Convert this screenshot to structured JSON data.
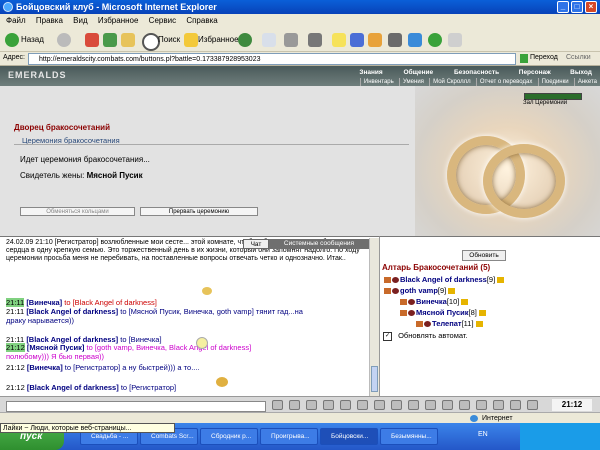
{
  "window": {
    "title": "Бойцовский клуб - Microsoft Internet Explorer"
  },
  "menu": [
    "Файл",
    "Правка",
    "Вид",
    "Избранное",
    "Сервис",
    "Справка"
  ],
  "toolbar": {
    "back": "Назад",
    "search": "Поиск",
    "favorites": "Избранное",
    "go": "Переход",
    "links": "Ссылки"
  },
  "address": {
    "label": "Адрес:",
    "url": "http://emeraldscity.combats.com/buttons.pl?battle=0.173387928953023"
  },
  "game_header": {
    "logo": "EMERALDS",
    "nav_top": [
      "Знания",
      "Общение",
      "Безопасность",
      "Персонаж",
      "Выход"
    ],
    "nav_bottom": [
      "Инвентарь",
      "Умения",
      "Мой Скроллл",
      "Отчет о переводах",
      "Поединки",
      "Анкета"
    ]
  },
  "main": {
    "hall_title": "Дворец бракосочетаний",
    "ceremony_tab": "Церемония бракосочетания",
    "ceremony_status": "Идет церемония бракосочетания...",
    "witness_label": "Свидетель жены:",
    "witness_name": "Мясной Пусик",
    "ceremony_text": "24.02.09 21:10 [Регистратор] возлюбленные мои сесте... этой комнате, чтобы объединить два любящих сердца в одну крепкую семью. Это торжественный день в их жизни, который они запомнят надолго. По ходу церемонии просьба меня не перебивать, на поставленные вопросы отвечать четко и однозначно. Итак..",
    "exchange_rings_button": "Обменяться кольцами",
    "interrupt_button": "Прервать церемонию",
    "ceremony_hall_label": "Зал Церемоний",
    "hp_fraction": 1.0
  },
  "chat": {
    "tab_chat": "Чат",
    "tab_system": "Системные сообщения",
    "lines": [
      {
        "time": "21:11",
        "time_green": true,
        "nick": "[Винечка]",
        "to": "to [Black Angel of darkness]",
        "to_red": true,
        "text": ""
      },
      {
        "time": "21:11",
        "time_green": false,
        "nick": "[Black Angel of darkness]",
        "to": "to [Мясной Пусик, Винечка, goth vamp]",
        "to_red": false,
        "text": " тянит гад...на"
      },
      {
        "time": "",
        "time_green": false,
        "nick": "",
        "to": "",
        "to_red": false,
        "text": "драку нарывается))"
      },
      {
        "time": "21:11",
        "time_green": false,
        "nick": "[Black Angel of darkness]",
        "to": "to [Винечка]",
        "to_red": false,
        "text": ""
      },
      {
        "time": "21:12",
        "time_green": true,
        "nick": "[Мясной Пусик]",
        "to": "to [goth vamp, Винечка, Black Angel of darkness]",
        "to_red": false,
        "text": ""
      },
      {
        "time": "",
        "time_green": false,
        "nick": "",
        "to": "",
        "to_red": false,
        "text": "полюбому))) Я бью первая))"
      },
      {
        "time": "21:12",
        "time_green": false,
        "nick": "[Винечка]",
        "to": "to [Регистратор] а ну быстрей))) а то....",
        "to_red": false,
        "text": ""
      },
      {
        "time": "21:12",
        "time_green": false,
        "nick": "[Black Angel of darkness]",
        "to": "to [Регистратор]",
        "to_red": false,
        "text": ""
      }
    ]
  },
  "altar": {
    "refresh_button": "Обновить",
    "title": "Алтарь Бракосочетаний (5)",
    "players": [
      {
        "name": "Black Angel of darkness",
        "level": "[9]"
      },
      {
        "name": "goth vamp",
        "level": "[9]"
      },
      {
        "name": "Винечка",
        "level": "[10]"
      },
      {
        "name": "Мясной Пусик",
        "level": "[8]"
      },
      {
        "name": "Телепат",
        "level": "[11]"
      }
    ],
    "auto_refresh": "Обновлять автомат.",
    "auto_checked": true
  },
  "bottom": {
    "clock": "21:12"
  },
  "status": {
    "left": "",
    "right": "Интернет"
  },
  "taskbar": {
    "start": "пуск",
    "balloon": "Лайки ~ Люди, которые веб-страницы...",
    "tasks": [
      "Свадьба - ...",
      "Combats Scr...",
      "Сбродник р...",
      "Проигрыва...",
      "Бойцовски...",
      "Безымянны..."
    ],
    "lang": "EN"
  },
  "colors": {
    "titlebar": "#0842b8",
    "hall_title": "#8b0000",
    "nick": "#000080",
    "pink": "#cc00cc",
    "green_time": "#80d180"
  }
}
